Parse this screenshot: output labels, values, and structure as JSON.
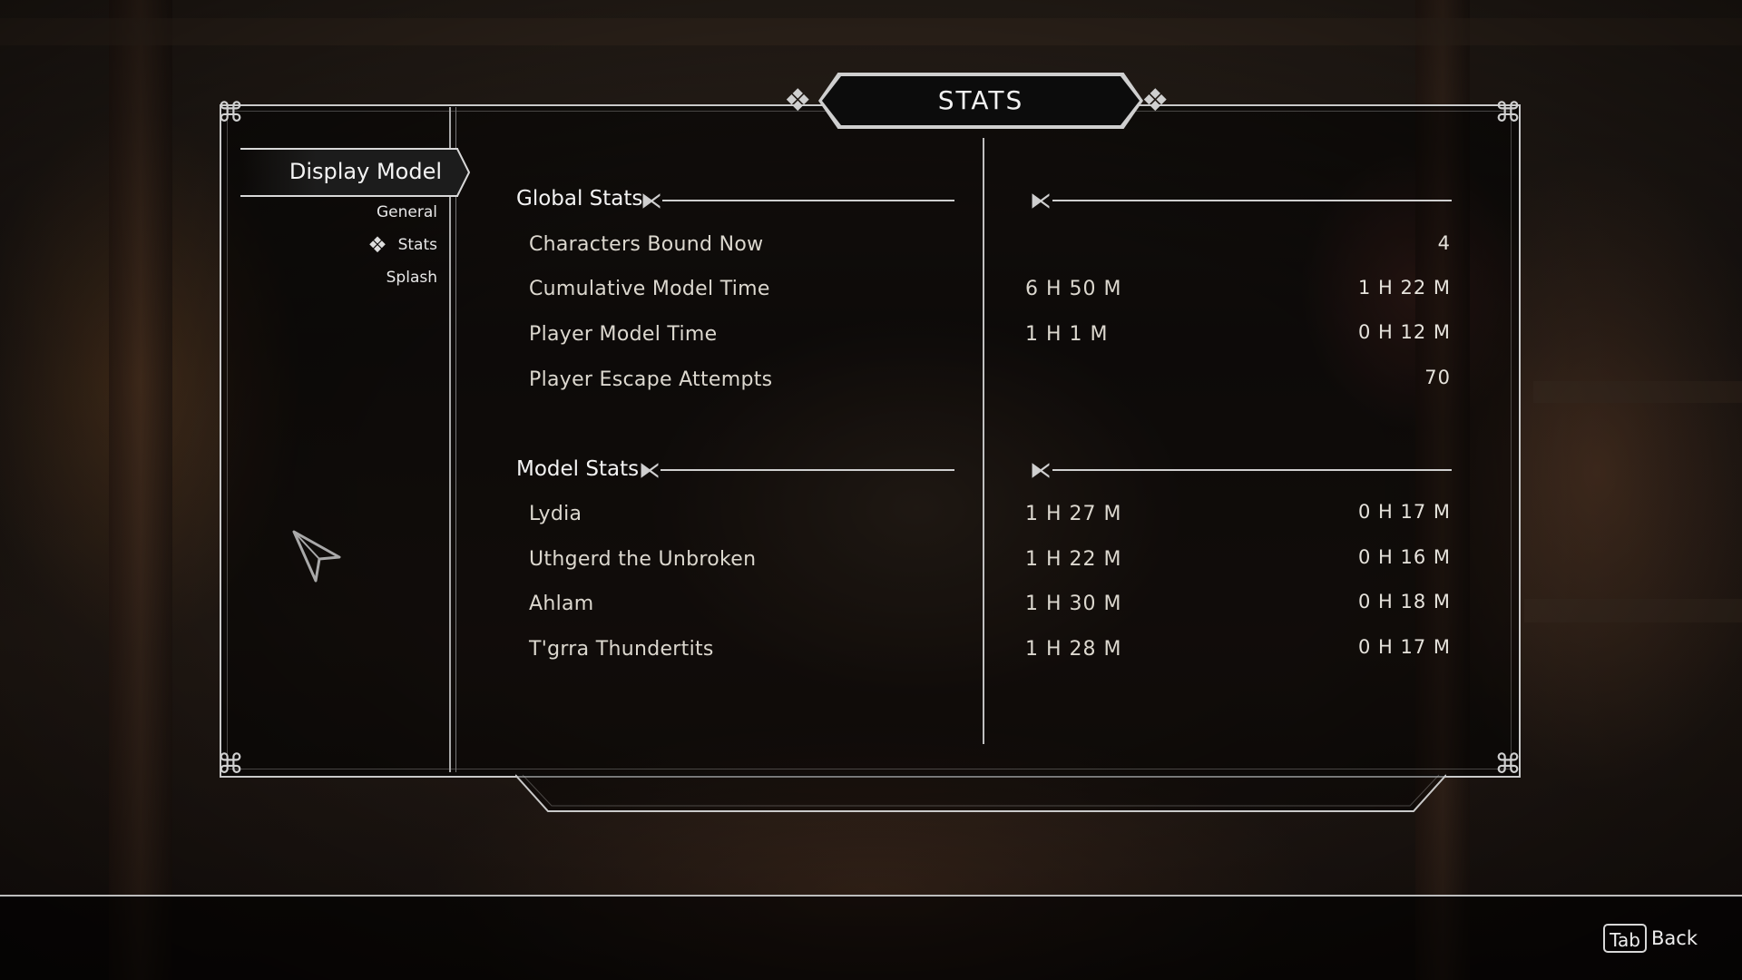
{
  "title": "STATS",
  "sidebar": {
    "active_item": "Display Model",
    "sub_items": [
      {
        "label": "General"
      },
      {
        "label": "Stats"
      },
      {
        "label": "Splash"
      }
    ]
  },
  "global_stats": {
    "heading": "Global Stats",
    "rows": [
      {
        "label": "Characters Bound Now",
        "value1": "",
        "value2": "4"
      },
      {
        "label": "Cumulative Model Time",
        "value1": "6 H 50 M",
        "value2": "1 H 22 M"
      },
      {
        "label": "Player Model Time",
        "value1": "1 H 1 M",
        "value2": "0 H 12 M"
      },
      {
        "label": "Player Escape Attempts",
        "value1": "",
        "value2": "70"
      }
    ]
  },
  "model_stats": {
    "heading": "Model Stats",
    "rows": [
      {
        "label": "Lydia",
        "value1": "1 H 27 M",
        "value2": "0 H 17 M"
      },
      {
        "label": "Uthgerd the Unbroken",
        "value1": "1 H 22 M",
        "value2": "0 H 16 M"
      },
      {
        "label": "Ahlam",
        "value1": "1 H 30 M",
        "value2": "0 H 18 M"
      },
      {
        "label": "T'grra Thundertits",
        "value1": "1 H 28 M",
        "value2": "0 H 17 M"
      }
    ]
  },
  "footer": {
    "key": "Tab",
    "action": "Back"
  },
  "colors": {
    "frame": "#c9c9c9",
    "text": "#dcd8cf",
    "panel": "#0c0c0c"
  }
}
